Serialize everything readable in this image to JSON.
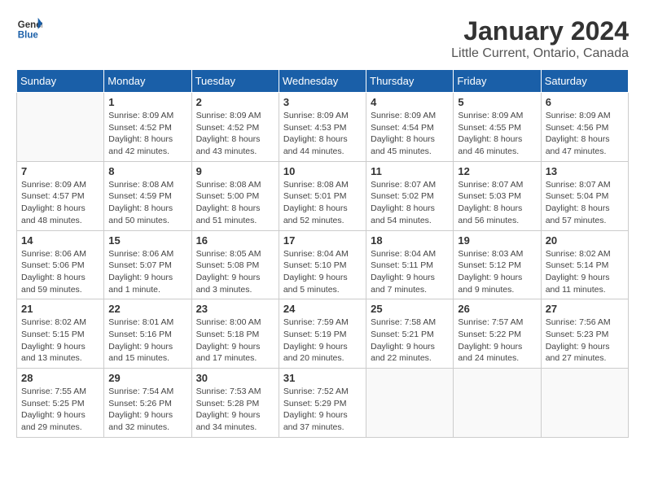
{
  "header": {
    "logo_line1": "General",
    "logo_line2": "Blue",
    "title": "January 2024",
    "subtitle": "Little Current, Ontario, Canada"
  },
  "days_of_week": [
    "Sunday",
    "Monday",
    "Tuesday",
    "Wednesday",
    "Thursday",
    "Friday",
    "Saturday"
  ],
  "weeks": [
    [
      {
        "date": "",
        "info": ""
      },
      {
        "date": "1",
        "info": "Sunrise: 8:09 AM\nSunset: 4:52 PM\nDaylight: 8 hours\nand 42 minutes."
      },
      {
        "date": "2",
        "info": "Sunrise: 8:09 AM\nSunset: 4:52 PM\nDaylight: 8 hours\nand 43 minutes."
      },
      {
        "date": "3",
        "info": "Sunrise: 8:09 AM\nSunset: 4:53 PM\nDaylight: 8 hours\nand 44 minutes."
      },
      {
        "date": "4",
        "info": "Sunrise: 8:09 AM\nSunset: 4:54 PM\nDaylight: 8 hours\nand 45 minutes."
      },
      {
        "date": "5",
        "info": "Sunrise: 8:09 AM\nSunset: 4:55 PM\nDaylight: 8 hours\nand 46 minutes."
      },
      {
        "date": "6",
        "info": "Sunrise: 8:09 AM\nSunset: 4:56 PM\nDaylight: 8 hours\nand 47 minutes."
      }
    ],
    [
      {
        "date": "7",
        "info": "Sunrise: 8:09 AM\nSunset: 4:57 PM\nDaylight: 8 hours\nand 48 minutes."
      },
      {
        "date": "8",
        "info": "Sunrise: 8:08 AM\nSunset: 4:59 PM\nDaylight: 8 hours\nand 50 minutes."
      },
      {
        "date": "9",
        "info": "Sunrise: 8:08 AM\nSunset: 5:00 PM\nDaylight: 8 hours\nand 51 minutes."
      },
      {
        "date": "10",
        "info": "Sunrise: 8:08 AM\nSunset: 5:01 PM\nDaylight: 8 hours\nand 52 minutes."
      },
      {
        "date": "11",
        "info": "Sunrise: 8:07 AM\nSunset: 5:02 PM\nDaylight: 8 hours\nand 54 minutes."
      },
      {
        "date": "12",
        "info": "Sunrise: 8:07 AM\nSunset: 5:03 PM\nDaylight: 8 hours\nand 56 minutes."
      },
      {
        "date": "13",
        "info": "Sunrise: 8:07 AM\nSunset: 5:04 PM\nDaylight: 8 hours\nand 57 minutes."
      }
    ],
    [
      {
        "date": "14",
        "info": "Sunrise: 8:06 AM\nSunset: 5:06 PM\nDaylight: 8 hours\nand 59 minutes."
      },
      {
        "date": "15",
        "info": "Sunrise: 8:06 AM\nSunset: 5:07 PM\nDaylight: 9 hours\nand 1 minute."
      },
      {
        "date": "16",
        "info": "Sunrise: 8:05 AM\nSunset: 5:08 PM\nDaylight: 9 hours\nand 3 minutes."
      },
      {
        "date": "17",
        "info": "Sunrise: 8:04 AM\nSunset: 5:10 PM\nDaylight: 9 hours\nand 5 minutes."
      },
      {
        "date": "18",
        "info": "Sunrise: 8:04 AM\nSunset: 5:11 PM\nDaylight: 9 hours\nand 7 minutes."
      },
      {
        "date": "19",
        "info": "Sunrise: 8:03 AM\nSunset: 5:12 PM\nDaylight: 9 hours\nand 9 minutes."
      },
      {
        "date": "20",
        "info": "Sunrise: 8:02 AM\nSunset: 5:14 PM\nDaylight: 9 hours\nand 11 minutes."
      }
    ],
    [
      {
        "date": "21",
        "info": "Sunrise: 8:02 AM\nSunset: 5:15 PM\nDaylight: 9 hours\nand 13 minutes."
      },
      {
        "date": "22",
        "info": "Sunrise: 8:01 AM\nSunset: 5:16 PM\nDaylight: 9 hours\nand 15 minutes."
      },
      {
        "date": "23",
        "info": "Sunrise: 8:00 AM\nSunset: 5:18 PM\nDaylight: 9 hours\nand 17 minutes."
      },
      {
        "date": "24",
        "info": "Sunrise: 7:59 AM\nSunset: 5:19 PM\nDaylight: 9 hours\nand 20 minutes."
      },
      {
        "date": "25",
        "info": "Sunrise: 7:58 AM\nSunset: 5:21 PM\nDaylight: 9 hours\nand 22 minutes."
      },
      {
        "date": "26",
        "info": "Sunrise: 7:57 AM\nSunset: 5:22 PM\nDaylight: 9 hours\nand 24 minutes."
      },
      {
        "date": "27",
        "info": "Sunrise: 7:56 AM\nSunset: 5:23 PM\nDaylight: 9 hours\nand 27 minutes."
      }
    ],
    [
      {
        "date": "28",
        "info": "Sunrise: 7:55 AM\nSunset: 5:25 PM\nDaylight: 9 hours\nand 29 minutes."
      },
      {
        "date": "29",
        "info": "Sunrise: 7:54 AM\nSunset: 5:26 PM\nDaylight: 9 hours\nand 32 minutes."
      },
      {
        "date": "30",
        "info": "Sunrise: 7:53 AM\nSunset: 5:28 PM\nDaylight: 9 hours\nand 34 minutes."
      },
      {
        "date": "31",
        "info": "Sunrise: 7:52 AM\nSunset: 5:29 PM\nDaylight: 9 hours\nand 37 minutes."
      },
      {
        "date": "",
        "info": ""
      },
      {
        "date": "",
        "info": ""
      },
      {
        "date": "",
        "info": ""
      }
    ]
  ]
}
